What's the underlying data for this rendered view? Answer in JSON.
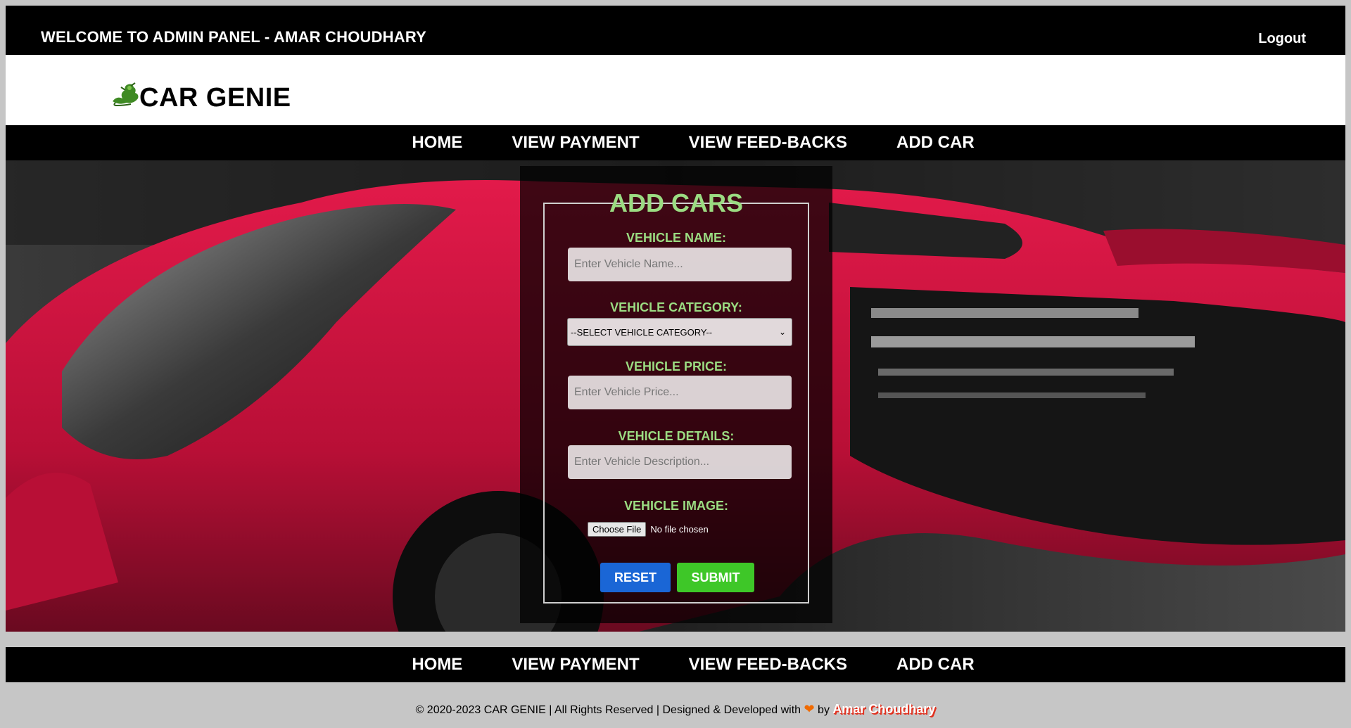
{
  "header": {
    "welcome_text": "WELCOME TO ADMIN PANEL - AMAR CHOUDHARY",
    "logout_label": "Logout"
  },
  "brand": {
    "name": "CAR GENIE",
    "logo_icon": "genie-icon"
  },
  "nav_top": {
    "items": [
      {
        "label": "HOME"
      },
      {
        "label": "VIEW PAYMENT"
      },
      {
        "label": "VIEW FEED-BACKS"
      },
      {
        "label": "ADD CAR"
      }
    ]
  },
  "form": {
    "title": "ADD CARS",
    "vehicle_name": {
      "label": "VEHICLE NAME:",
      "placeholder": "Enter Vehicle Name...",
      "value": ""
    },
    "vehicle_category": {
      "label": "VEHICLE CATEGORY:",
      "selected": "--SELECT VEHICLE CATEGORY--"
    },
    "vehicle_price": {
      "label": "VEHICLE PRICE:",
      "placeholder": "Enter Vehicle Price...",
      "value": ""
    },
    "vehicle_details": {
      "label": "VEHICLE DETAILS:",
      "placeholder": "Enter Vehicle Description...",
      "value": ""
    },
    "vehicle_image": {
      "label": "VEHICLE IMAGE:",
      "button_label": "Choose File",
      "status": "No file chosen"
    },
    "reset_label": "RESET",
    "submit_label": "SUBMIT"
  },
  "nav_bottom": {
    "items": [
      {
        "label": "HOME"
      },
      {
        "label": "VIEW PAYMENT"
      },
      {
        "label": "VIEW FEED-BACKS"
      },
      {
        "label": "ADD CAR"
      }
    ]
  },
  "footer": {
    "text": "© 2020-2023 CAR GENIE | All Rights Reserved | Designed & Developed with",
    "by": "by",
    "author": "Amar Choudhary",
    "heart_icon": "heart-icon"
  },
  "colors": {
    "form_accent": "#9bdc82",
    "reset_button": "#1a66d6",
    "submit_button": "#3ec728",
    "car_red": "#d01540"
  }
}
